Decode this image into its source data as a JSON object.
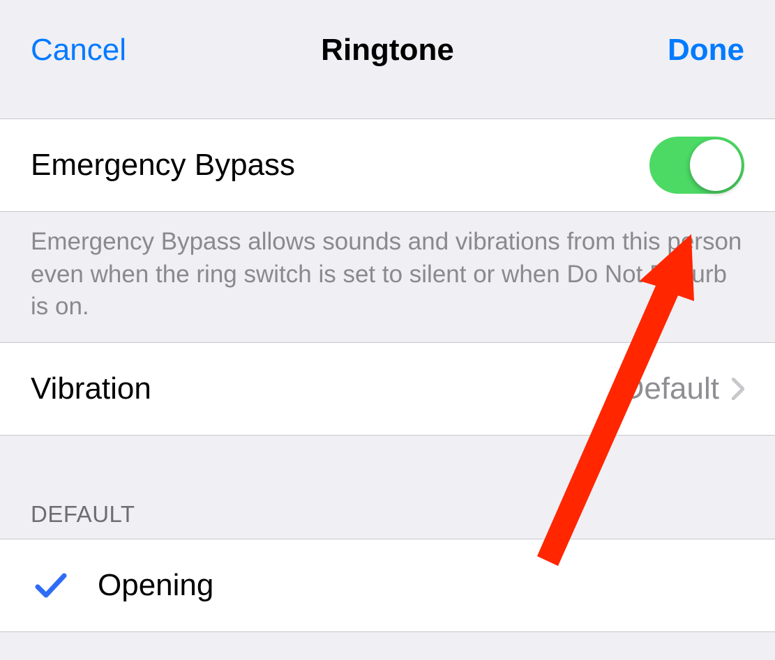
{
  "navbar": {
    "cancel": "Cancel",
    "title": "Ringtone",
    "done": "Done"
  },
  "emergencyBypass": {
    "label": "Emergency Bypass",
    "on": true,
    "footer": "Emergency Bypass allows sounds and vibrations from this person even when the ring switch is set to silent or when Do Not Disturb is on."
  },
  "vibration": {
    "label": "Vibration",
    "value": "Default"
  },
  "defaultSection": {
    "header": "DEFAULT",
    "selected": "Opening"
  },
  "colors": {
    "accent": "#007aff",
    "switch_on": "#4cd964",
    "annotation_arrow": "#ff2600"
  }
}
